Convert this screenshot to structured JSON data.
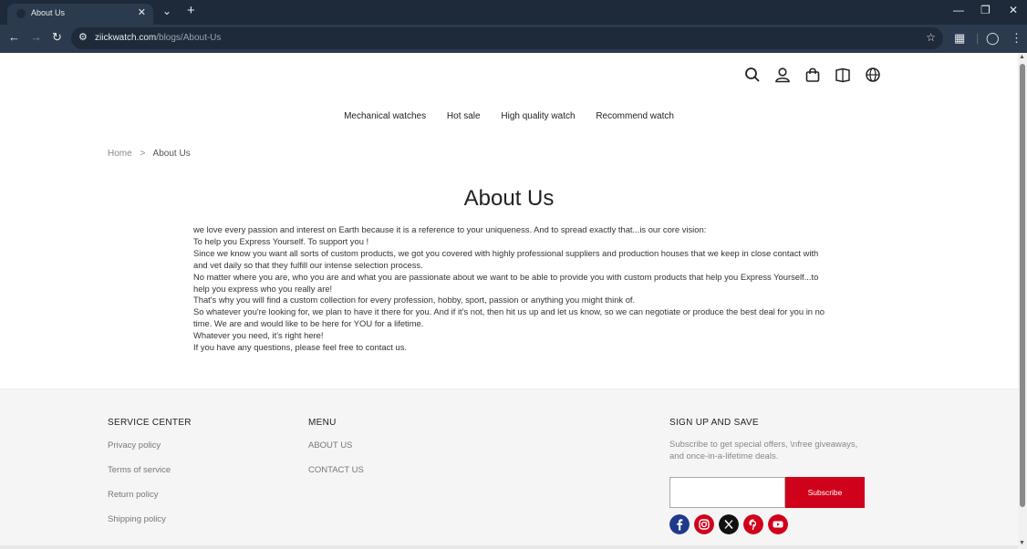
{
  "browser": {
    "tab_title": "About Us",
    "tab_close": "✕",
    "tab_list": "⌄",
    "new_tab": "+",
    "url_domain": "ziickwatch.com",
    "url_path": "/blogs/About-Us"
  },
  "header": {
    "icons": [
      "search-icon",
      "account-icon",
      "cart-icon",
      "book-icon",
      "globe-icon"
    ]
  },
  "nav": {
    "items": [
      "Mechanical watches",
      "Hot sale",
      "High quality watch",
      "Recommend watch"
    ]
  },
  "breadcrumb": {
    "home": "Home",
    "separator": ">",
    "current": "About Us"
  },
  "page": {
    "title": "About Us",
    "lines": [
      "we love every passion and interest on Earth because it is a reference to your uniqueness. And to spread exactly that...is our core vision:",
      "To help you Express Yourself. To support you !",
      "Since we know you want all sorts of custom products, we got you covered with highly professional suppliers and production houses that we keep in close contact with",
      "and vet daily so that they fulfill our intense selection process.",
      "No matter where you are, who you are and what you are passionate about we want to be able to provide you with custom products that help you Express Yourself...to",
      "help you express who you really are!",
      "That's why you will find a custom collection for every profession, hobby, sport, passion or anything you might think of.",
      "So whatever you're looking for, we plan to have it there for you. And if it's not, then hit us up and let us know, so we can negotiate or produce the best deal for you in no",
      "time. We are and would like to be here for YOU for a lifetime.",
      "Whatever you need, it's right here!",
      "If you have any questions, please feel free to contact us."
    ]
  },
  "footer": {
    "service_title": "SERVICE CENTER",
    "service_links": [
      "Privacy policy",
      "Terms of service",
      "Return policy",
      "Shipping policy"
    ],
    "menu_title": "MENU",
    "menu_links": [
      "ABOUT US",
      "CONTACT US"
    ],
    "signup_title": "SIGN UP AND SAVE",
    "signup_desc": "Subscribe to get special offers, \\nfree giveaways, and once-in-a-lifetime deals.",
    "subscribe_label": "Subscribe",
    "social": [
      "facebook-icon",
      "instagram-icon",
      "x-icon",
      "pinterest-icon",
      "youtube-icon"
    ]
  },
  "colors": {
    "accent": "#d0021b",
    "chrome_dark": "#1e2a3a",
    "chrome_toolbar": "#2b3a4d",
    "footer_bg": "#f5f5f5"
  }
}
